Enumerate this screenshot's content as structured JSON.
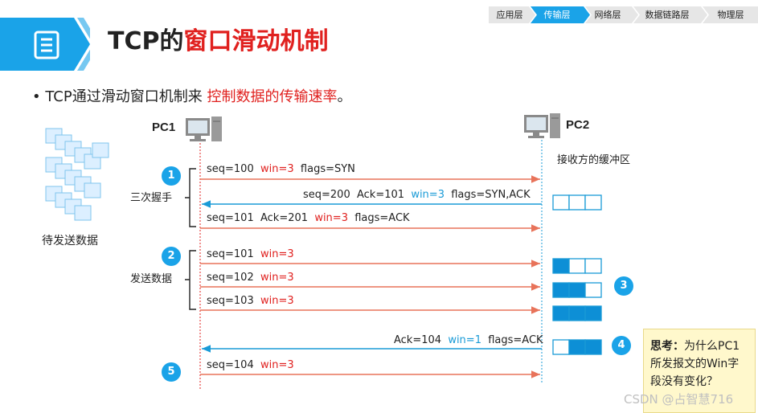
{
  "breadcrumb": [
    "应用层",
    "传输层",
    "网络层",
    "数据链路层",
    "物理层"
  ],
  "breadcrumb_active": 1,
  "title": {
    "prefix": "TCP的",
    "highlight": "窗口滑动机制"
  },
  "bullet": {
    "text": "TCP通过滑动窗口机制来",
    "highlight": "控制数据的传输速率",
    "suffix": "。"
  },
  "hosts": {
    "left": "PC1",
    "right": "PC2"
  },
  "buffer_label": "接收方的缓冲区",
  "send_data_label": "待发送数据",
  "phase_labels": {
    "handshake": "三次握手",
    "send": "发送数据"
  },
  "steps": [
    "1",
    "2",
    "3",
    "4",
    "5"
  ],
  "messages": {
    "m1": {
      "seq": "seq=100",
      "win": "win=3",
      "flags": "flags=SYN"
    },
    "m2": {
      "seq": "seq=200",
      "ack": "Ack=101",
      "win": "win=3",
      "flags": "flags=SYN,ACK"
    },
    "m3": {
      "seq": "seq=101",
      "ack": "Ack=201",
      "win": "win=3",
      "flags": "flags=ACK"
    },
    "m4": {
      "seq": "seq=101",
      "win": "win=3"
    },
    "m5": {
      "seq": "seq=102",
      "win": "win=3"
    },
    "m6": {
      "seq": "seq=103",
      "win": "win=3"
    },
    "m7": {
      "ack": "Ack=104",
      "win": "win=1",
      "flags": "flags=ACK"
    },
    "m8": {
      "seq": "seq=104",
      "win": "win=3"
    }
  },
  "think": {
    "head": "思考：",
    "body": "为什么PC1所发报文的Win字段没有变化？"
  },
  "watermark": "CSDN @占智慧716",
  "colors": {
    "accent_red": "#e0211f",
    "accent_blue": "#1a9bd7",
    "arrow_red": "#e8735a",
    "step_blue": "#1aa3e8",
    "note_bg": "#fff8cc"
  }
}
